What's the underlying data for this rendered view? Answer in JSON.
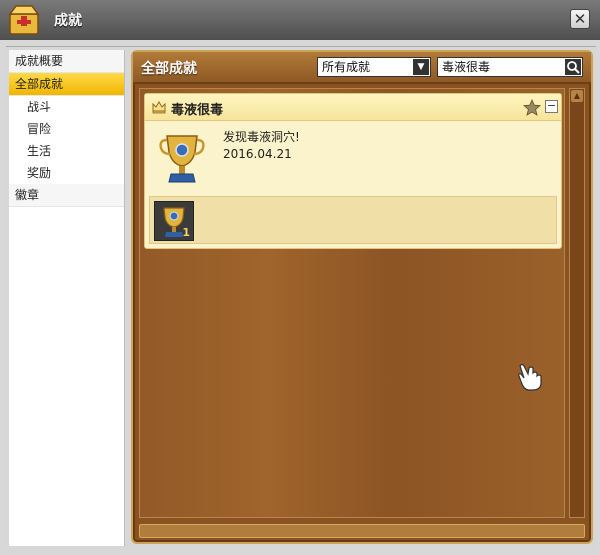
{
  "window": {
    "title": "成就",
    "close_label": "✕"
  },
  "sidebar": {
    "items": [
      {
        "label": "成就概要",
        "level": 0,
        "active": false
      },
      {
        "label": "全部成就",
        "level": 0,
        "active": true
      },
      {
        "label": "战斗",
        "level": 1,
        "active": false
      },
      {
        "label": "冒险",
        "level": 1,
        "active": false
      },
      {
        "label": "生活",
        "level": 1,
        "active": false
      },
      {
        "label": "奖励",
        "level": 1,
        "active": false
      },
      {
        "label": "徽章",
        "level": 0,
        "active": false
      }
    ]
  },
  "main": {
    "title": "全部成就",
    "filter": {
      "selected": "所有成就"
    },
    "search": {
      "value": "毒液很毒"
    }
  },
  "achievement": {
    "name": "毒液很毒",
    "description": "发现毒液洞穴!",
    "date": "2016.04.21",
    "collapse_label": "−",
    "reward_count": "1"
  },
  "colors": {
    "accent": "#f1b600",
    "panel_wood": "#8a5221",
    "card_bg": "#fbf3cb"
  }
}
